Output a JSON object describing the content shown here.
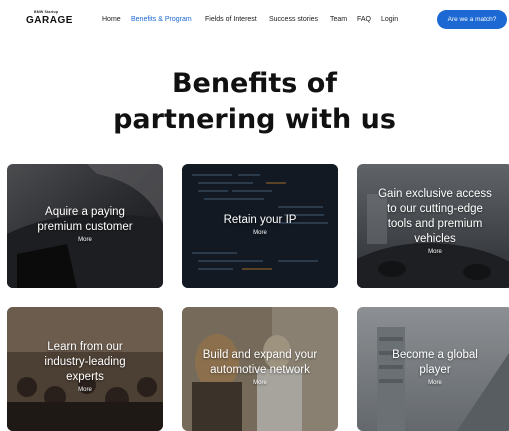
{
  "header": {
    "logo_small": "BMW Startup",
    "logo_big": "GARAGE",
    "nav": [
      {
        "label": "Home",
        "active": false
      },
      {
        "label": "Benefits & Program",
        "active": true
      },
      {
        "label": "Fields of Interest",
        "active": false
      },
      {
        "label": "Success stories",
        "active": false
      },
      {
        "label": "Team",
        "active": false
      },
      {
        "label": "FAQ",
        "active": false
      },
      {
        "label": "Login",
        "active": false
      }
    ],
    "cta_label": "Are we a match?"
  },
  "main": {
    "title_line1": "Benefits of",
    "title_line2": "partnering with us",
    "cards": [
      {
        "lines": [
          "Aquire a paying",
          "premium customer"
        ],
        "more": "More"
      },
      {
        "lines": [
          "Retain your IP"
        ],
        "more": "More"
      },
      {
        "lines": [
          "Gain exclusive access",
          "to our cutting-edge",
          "tools and premium",
          "vehicles"
        ],
        "more": "More"
      },
      {
        "lines": [
          "Learn from our",
          "industry-leading",
          "experts"
        ],
        "more": "More"
      },
      {
        "lines": [
          "Build and expand your",
          "automotive network"
        ],
        "more": "More"
      },
      {
        "lines": [
          "Become a global",
          "player"
        ],
        "more": "More"
      }
    ]
  },
  "colors": {
    "accent": "#1c69d4",
    "text": "#111111",
    "background": "#ffffff"
  }
}
